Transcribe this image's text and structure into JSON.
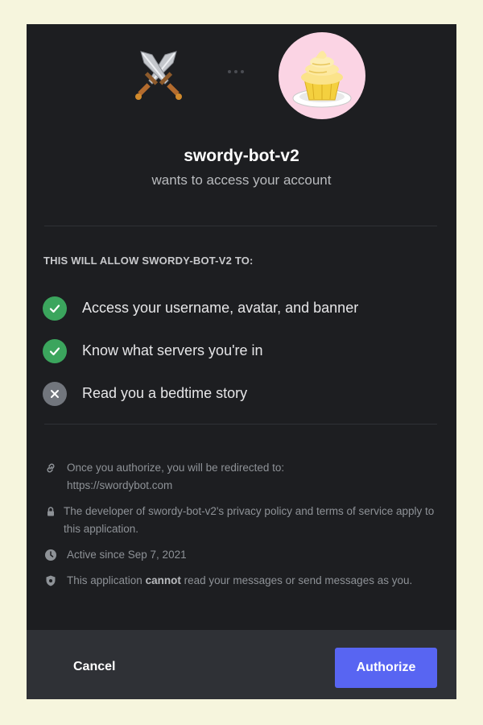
{
  "app": {
    "name": "swordy-bot-v2",
    "subtitle": "wants to access your account",
    "icon": "crossed-swords-icon",
    "user_avatar": "cupcake-avatar"
  },
  "permissions": {
    "heading": "THIS WILL ALLOW SWORDY-BOT-V2 TO:",
    "items": [
      {
        "label": "Access your username, avatar, and banner",
        "granted": true,
        "icon": "check-icon"
      },
      {
        "label": "Know what servers you're in",
        "granted": true,
        "icon": "check-icon"
      },
      {
        "label": "Read you a bedtime story",
        "granted": false,
        "icon": "x-icon"
      }
    ]
  },
  "info": {
    "redirect_line1": "Once you authorize, you will be redirected to:",
    "redirect_url": "https://swordybot.com",
    "privacy": "The developer of swordy-bot-v2's privacy policy and terms of service apply to this application.",
    "active_since": "Active since Sep 7, 2021",
    "messages_prefix": "This application ",
    "messages_bold": "cannot",
    "messages_suffix": " read your messages or send messages as you."
  },
  "footer": {
    "cancel_label": "Cancel",
    "authorize_label": "Authorize"
  },
  "colors": {
    "background": "#f6f5dd",
    "modal": "#1d1e21",
    "footer": "#2f3136",
    "accent": "#5865f2",
    "granted": "#3ba55d",
    "denied": "#72767d"
  }
}
